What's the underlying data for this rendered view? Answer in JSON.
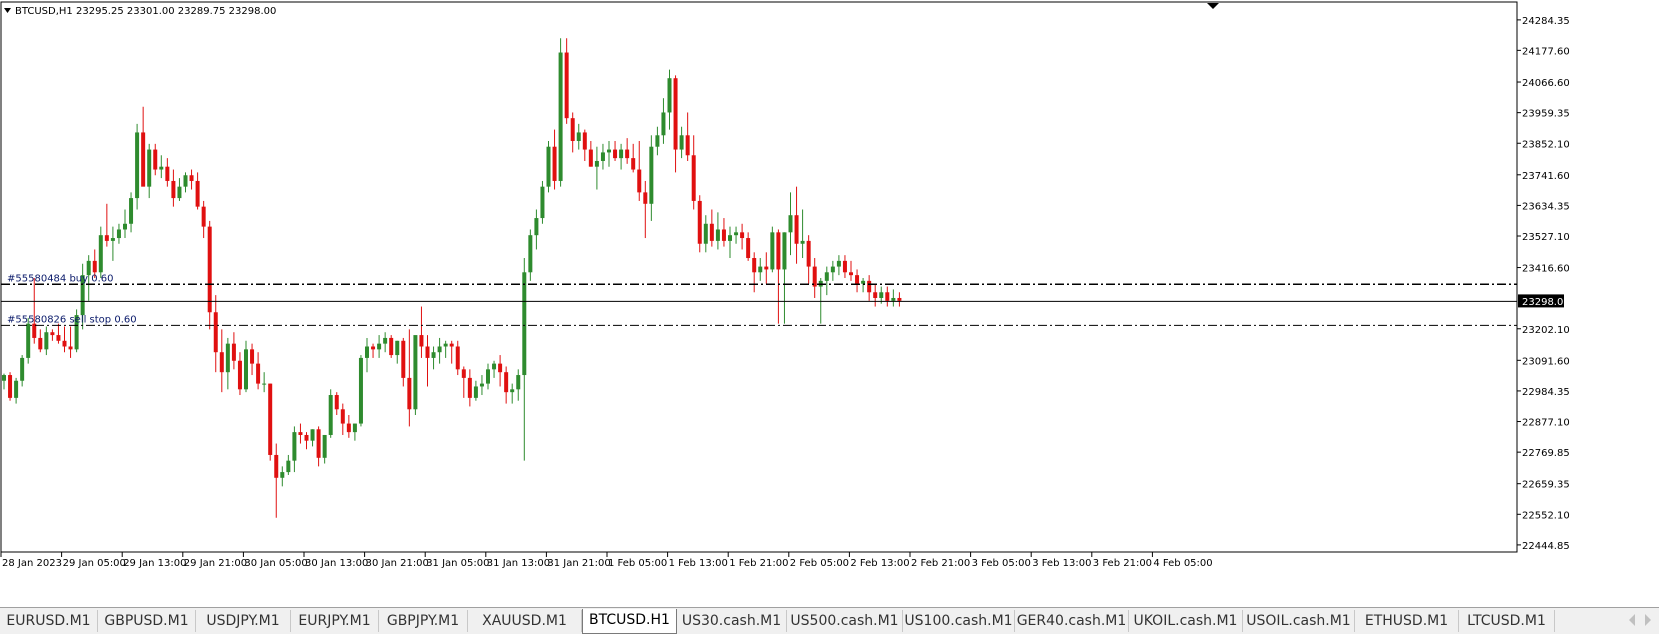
{
  "header": {
    "symbol_label": "BTCUSD,H1",
    "ohlc": "23295.25 23301.00 23289.75 23298.00"
  },
  "orders": {
    "buy_label": "#55580484 buy 0.60",
    "sell_label": "#55580826 sell stop 0.60",
    "buy_price": 23358,
    "sell_stop_price": 23214
  },
  "price_axis": {
    "ticks": [
      "24284.35",
      "24177.60",
      "24066.60",
      "23959.35",
      "23852.10",
      "23741.60",
      "23634.35",
      "23527.10",
      "23416.60",
      "23202.10",
      "23091.60",
      "22984.35",
      "22877.10",
      "22769.85",
      "22659.35",
      "22552.10",
      "22444.85"
    ],
    "current_price": "23298.00"
  },
  "time_axis": {
    "labels": [
      "28 Jan 2023",
      "29 Jan 05:00",
      "29 Jan 13:00",
      "29 Jan 21:00",
      "30 Jan 05:00",
      "30 Jan 13:00",
      "30 Jan 21:00",
      "31 Jan 05:00",
      "31 Jan 13:00",
      "31 Jan 21:00",
      "1 Feb 05:00",
      "1 Feb 13:00",
      "1 Feb 21:00",
      "2 Feb 05:00",
      "2 Feb 13:00",
      "2 Feb 21:00",
      "3 Feb 05:00",
      "3 Feb 13:00",
      "3 Feb 21:00",
      "4 Feb 05:00"
    ]
  },
  "colors": {
    "bull": "#2e8b2e",
    "bear": "#e01010"
  },
  "tabs": [
    {
      "label": "EURUSD.M1"
    },
    {
      "label": "GBPUSD.M1"
    },
    {
      "label": "USDJPY.M1"
    },
    {
      "label": "EURJPY.M1"
    },
    {
      "label": "GBPJPY.M1"
    },
    {
      "label": "XAUUSD.M1"
    },
    {
      "label": "BTCUSD.H1",
      "active": true
    },
    {
      "label": "US30.cash.M1"
    },
    {
      "label": "US500.cash.M1"
    },
    {
      "label": "US100.cash.M1"
    },
    {
      "label": "GER40.cash.M1"
    },
    {
      "label": "UKOIL.cash.M1"
    },
    {
      "label": "USOIL.cash.M1"
    },
    {
      "label": "ETHUSD.M1"
    },
    {
      "label": "LTCUSD.M1"
    }
  ],
  "chart_data": {
    "type": "candlestick",
    "symbol": "BTCUSD",
    "timeframe": "H1",
    "ylim": [
      22420,
      24340
    ],
    "candles": [
      [
        23020,
        23045,
        22990,
        23040
      ],
      [
        23040,
        23050,
        22950,
        22960
      ],
      [
        22960,
        23030,
        22940,
        23020
      ],
      [
        23020,
        23110,
        23000,
        23100
      ],
      [
        23100,
        23240,
        23080,
        23220
      ],
      [
        23220,
        23380,
        23150,
        23170
      ],
      [
        23170,
        23200,
        23120,
        23130
      ],
      [
        23130,
        23210,
        23110,
        23190
      ],
      [
        23190,
        23200,
        23160,
        23180
      ],
      [
        23180,
        23220,
        23150,
        23160
      ],
      [
        23160,
        23210,
        23120,
        23140
      ],
      [
        23140,
        23210,
        23100,
        23130
      ],
      [
        23130,
        23270,
        23120,
        23250
      ],
      [
        23250,
        23430,
        23200,
        23390
      ],
      [
        23390,
        23460,
        23300,
        23440
      ],
      [
        23440,
        23480,
        23380,
        23400
      ],
      [
        23400,
        23560,
        23380,
        23530
      ],
      [
        23530,
        23640,
        23490,
        23510
      ],
      [
        23510,
        23560,
        23440,
        23520
      ],
      [
        23520,
        23570,
        23500,
        23550
      ],
      [
        23550,
        23620,
        23520,
        23570
      ],
      [
        23570,
        23680,
        23540,
        23660
      ],
      [
        23660,
        23920,
        23620,
        23890
      ],
      [
        23890,
        23980,
        23740,
        23700
      ],
      [
        23700,
        23850,
        23660,
        23830
      ],
      [
        23830,
        23850,
        23740,
        23760
      ],
      [
        23760,
        23810,
        23730,
        23770
      ],
      [
        23770,
        23800,
        23700,
        23720
      ],
      [
        23720,
        23760,
        23630,
        23660
      ],
      [
        23660,
        23730,
        23650,
        23700
      ],
      [
        23700,
        23750,
        23680,
        23740
      ],
      [
        23740,
        23760,
        23690,
        23720
      ],
      [
        23720,
        23750,
        23620,
        23630
      ],
      [
        23630,
        23650,
        23520,
        23560
      ],
      [
        23560,
        23580,
        23200,
        23260
      ],
      [
        23260,
        23320,
        23050,
        23120
      ],
      [
        23120,
        23200,
        22980,
        23050
      ],
      [
        23050,
        23170,
        22990,
        23150
      ],
      [
        23150,
        23190,
        23060,
        23090
      ],
      [
        23090,
        23120,
        22970,
        22990
      ],
      [
        22990,
        23160,
        22980,
        23130
      ],
      [
        23130,
        23150,
        23040,
        23080
      ],
      [
        23080,
        23120,
        22990,
        23010
      ],
      [
        23010,
        23050,
        22980,
        23010
      ],
      [
        23010,
        23010,
        22740,
        22760
      ],
      [
        22760,
        22800,
        22540,
        22680
      ],
      [
        22680,
        22720,
        22650,
        22700
      ],
      [
        22700,
        22760,
        22690,
        22740
      ],
      [
        22740,
        22860,
        22700,
        22840
      ],
      [
        22840,
        22870,
        22800,
        22830
      ],
      [
        22830,
        22840,
        22780,
        22810
      ],
      [
        22810,
        22850,
        22790,
        22850
      ],
      [
        22850,
        22860,
        22720,
        22750
      ],
      [
        22750,
        22830,
        22730,
        22830
      ],
      [
        22830,
        22990,
        22820,
        22970
      ],
      [
        22970,
        22980,
        22900,
        22920
      ],
      [
        22920,
        22940,
        22830,
        22870
      ],
      [
        22870,
        22900,
        22820,
        22840
      ],
      [
        22840,
        22870,
        22810,
        22870
      ],
      [
        22870,
        23110,
        22860,
        23100
      ],
      [
        23100,
        23170,
        23050,
        23140
      ],
      [
        23140,
        23150,
        23100,
        23130
      ],
      [
        23130,
        23180,
        23100,
        23150
      ],
      [
        23150,
        23190,
        23120,
        23170
      ],
      [
        23170,
        23180,
        23100,
        23110
      ],
      [
        23110,
        23160,
        23080,
        23160
      ],
      [
        23160,
        23170,
        23000,
        23030
      ],
      [
        23030,
        23200,
        22860,
        22920
      ],
      [
        22920,
        23160,
        22900,
        23180
      ],
      [
        23180,
        23280,
        23100,
        23140
      ],
      [
        23140,
        23180,
        23000,
        23100
      ],
      [
        23100,
        23140,
        23060,
        23120
      ],
      [
        23120,
        23170,
        23080,
        23140
      ],
      [
        23140,
        23160,
        23100,
        23150
      ],
      [
        23150,
        23160,
        23080,
        23140
      ],
      [
        23140,
        23160,
        23040,
        23060
      ],
      [
        23060,
        23070,
        22960,
        23030
      ],
      [
        23030,
        23060,
        22930,
        22960
      ],
      [
        22960,
        23020,
        22950,
        23000
      ],
      [
        23000,
        23040,
        22970,
        23010
      ],
      [
        23010,
        23080,
        22990,
        23060
      ],
      [
        23060,
        23090,
        23030,
        23080
      ],
      [
        23080,
        23110,
        23000,
        23050
      ],
      [
        23050,
        23070,
        22940,
        22980
      ],
      [
        22980,
        23010,
        22940,
        22990
      ],
      [
        22990,
        23060,
        22950,
        23040
      ],
      [
        23040,
        23450,
        22740,
        23400
      ],
      [
        23400,
        23550,
        23370,
        23530
      ],
      [
        23530,
        23620,
        23480,
        23590
      ],
      [
        23590,
        23720,
        23570,
        23700
      ],
      [
        23700,
        23860,
        23680,
        23840
      ],
      [
        23840,
        23900,
        23690,
        23720
      ],
      [
        23720,
        24220,
        23700,
        24170
      ],
      [
        24170,
        24220,
        23920,
        23940
      ],
      [
        23940,
        23960,
        23820,
        23860
      ],
      [
        23860,
        23920,
        23830,
        23890
      ],
      [
        23890,
        23900,
        23790,
        23830
      ],
      [
        23830,
        23860,
        23770,
        23770
      ],
      [
        23770,
        23840,
        23690,
        23790
      ],
      [
        23790,
        23850,
        23760,
        23820
      ],
      [
        23820,
        23860,
        23770,
        23830
      ],
      [
        23830,
        23860,
        23790,
        23800
      ],
      [
        23800,
        23850,
        23760,
        23830
      ],
      [
        23830,
        23870,
        23780,
        23800
      ],
      [
        23800,
        23850,
        23750,
        23760
      ],
      [
        23760,
        23860,
        23650,
        23680
      ],
      [
        23680,
        23720,
        23520,
        23640
      ],
      [
        23640,
        23880,
        23580,
        23840
      ],
      [
        23840,
        23910,
        23810,
        23880
      ],
      [
        23880,
        24010,
        23850,
        23960
      ],
      [
        23960,
        24110,
        23900,
        24080
      ],
      [
        24080,
        24090,
        23750,
        23830
      ],
      [
        23830,
        23910,
        23800,
        23880
      ],
      [
        23880,
        23960,
        23790,
        23810
      ],
      [
        23810,
        23880,
        23620,
        23650
      ],
      [
        23650,
        23670,
        23470,
        23500
      ],
      [
        23500,
        23600,
        23470,
        23570
      ],
      [
        23570,
        23620,
        23490,
        23510
      ],
      [
        23510,
        23610,
        23480,
        23550
      ],
      [
        23550,
        23590,
        23490,
        23510
      ],
      [
        23510,
        23560,
        23450,
        23530
      ],
      [
        23530,
        23560,
        23500,
        23540
      ],
      [
        23540,
        23570,
        23480,
        23520
      ],
      [
        23520,
        23540,
        23440,
        23450
      ],
      [
        23450,
        23470,
        23330,
        23400
      ],
      [
        23400,
        23450,
        23370,
        23420
      ],
      [
        23420,
        23470,
        23360,
        23410
      ],
      [
        23410,
        23560,
        23400,
        23540
      ],
      [
        23540,
        23550,
        23220,
        23410
      ],
      [
        23410,
        23540,
        23220,
        23540
      ],
      [
        23540,
        23680,
        23460,
        23600
      ],
      [
        23600,
        23700,
        23430,
        23500
      ],
      [
        23500,
        23620,
        23450,
        23510
      ],
      [
        23510,
        23530,
        23360,
        23420
      ],
      [
        23420,
        23450,
        23310,
        23350
      ],
      [
        23350,
        23380,
        23220,
        23370
      ],
      [
        23370,
        23420,
        23320,
        23400
      ],
      [
        23400,
        23440,
        23370,
        23420
      ],
      [
        23420,
        23460,
        23390,
        23440
      ],
      [
        23440,
        23460,
        23380,
        23400
      ],
      [
        23400,
        23440,
        23370,
        23390
      ],
      [
        23390,
        23410,
        23330,
        23360
      ],
      [
        23360,
        23380,
        23330,
        23370
      ],
      [
        23370,
        23390,
        23300,
        23330
      ],
      [
        23330,
        23360,
        23280,
        23310
      ],
      [
        23310,
        23350,
        23290,
        23330
      ],
      [
        23330,
        23350,
        23280,
        23300
      ],
      [
        23300,
        23340,
        23280,
        23310
      ],
      [
        23310,
        23330,
        23280,
        23300
      ]
    ]
  }
}
